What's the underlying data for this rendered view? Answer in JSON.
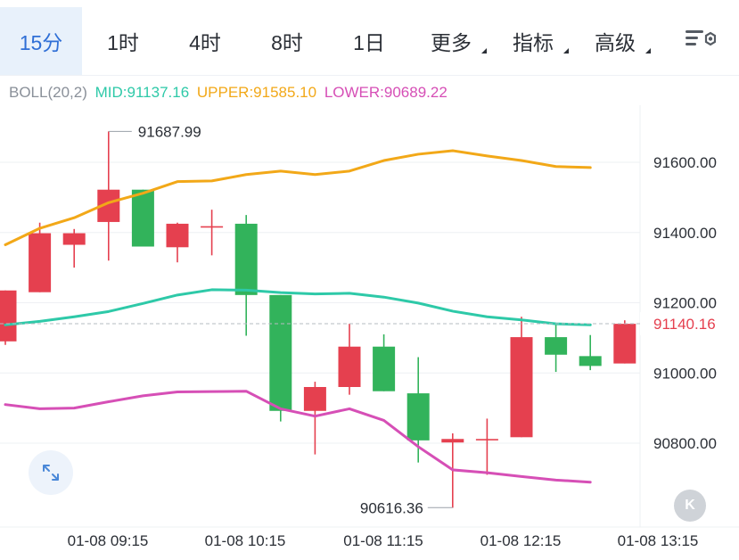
{
  "tabs": [
    {
      "label": "15分",
      "active": true,
      "caret": false
    },
    {
      "label": "1时",
      "active": false,
      "caret": false
    },
    {
      "label": "4时",
      "active": false,
      "caret": false
    },
    {
      "label": "8时",
      "active": false,
      "caret": false
    },
    {
      "label": "1日",
      "active": false,
      "caret": false
    },
    {
      "label": "更多",
      "active": false,
      "caret": true
    },
    {
      "label": "指标",
      "active": false,
      "caret": true
    },
    {
      "label": "高级",
      "active": false,
      "caret": true
    }
  ],
  "icons": {
    "settings": "chart-settings-icon",
    "expand": "expand-icon",
    "collapse": "k-collapse-icon"
  },
  "boll": {
    "name": "BOLL(20,2)",
    "mid": "MID:91137.16",
    "upper": "UPPER:91585.10",
    "lower": "LOWER:90689.22"
  },
  "colors": {
    "up": "#e5404f",
    "down": "#32b35b",
    "mid": "#2ec9a8",
    "upper": "#f2a818",
    "lower": "#d64fb6",
    "last_price": "#e5404f",
    "accent": "#2f6fd6"
  },
  "kbutton_label": "K",
  "chart_data": {
    "type": "candlestick",
    "y_ticks": [
      "91600.00",
      "91400.00",
      "91200.00",
      "91000.00",
      "90800.00"
    ],
    "y_tick_values": [
      91600,
      91400,
      91200,
      91000,
      90800
    ],
    "x_labels": [
      "01-08 09:15",
      "01-08 10:15",
      "01-08 11:15",
      "01-08 12:15",
      "01-08 13:15"
    ],
    "last_price": 91140.16,
    "last_price_label": "91140.16",
    "max_label": "91687.99",
    "min_label": "90616.36",
    "max_value": 91687.99,
    "min_value": 90616.36,
    "candles": [
      {
        "o": 91090,
        "h": 91235,
        "l": 91080,
        "c": 91235
      },
      {
        "o": 91230,
        "h": 91428,
        "l": 91230,
        "c": 91398
      },
      {
        "o": 91365,
        "h": 91410,
        "l": 91300,
        "c": 91398
      },
      {
        "o": 91430,
        "h": 91688,
        "l": 91320,
        "c": 91522
      },
      {
        "o": 91522,
        "h": 91522,
        "l": 91360,
        "c": 91360
      },
      {
        "o": 91358,
        "h": 91428,
        "l": 91315,
        "c": 91425
      },
      {
        "o": 91418,
        "h": 91465,
        "l": 91335,
        "c": 91418
      },
      {
        "o": 91425,
        "h": 91450,
        "l": 91106,
        "c": 91222
      },
      {
        "o": 91222,
        "h": 91222,
        "l": 90862,
        "c": 90892
      },
      {
        "o": 90892,
        "h": 90975,
        "l": 90768,
        "c": 90960
      },
      {
        "o": 90960,
        "h": 91140,
        "l": 90938,
        "c": 91075
      },
      {
        "o": 91075,
        "h": 91110,
        "l": 90948,
        "c": 90948
      },
      {
        "o": 90942,
        "h": 91045,
        "l": 90745,
        "c": 90808
      },
      {
        "o": 90802,
        "h": 90828,
        "l": 90616,
        "c": 90812
      },
      {
        "o": 90812,
        "h": 90870,
        "l": 90710,
        "c": 90812
      },
      {
        "o": 90817,
        "h": 91160,
        "l": 90817,
        "c": 91102
      },
      {
        "o": 91102,
        "h": 91140,
        "l": 91003,
        "c": 91052
      },
      {
        "o": 91048,
        "h": 91108,
        "l": 91008,
        "c": 91020
      },
      {
        "o": 91027,
        "h": 91150,
        "l": 91027,
        "c": 91140
      }
    ],
    "upper": [
      91365,
      91412,
      91442,
      91485,
      91512,
      91545,
      91547,
      91565,
      91575,
      91565,
      91575,
      91605,
      91623,
      91633,
      91618,
      91605,
      91588,
      91585
    ],
    "mid": [
      91137,
      91147,
      91160,
      91175,
      91198,
      91222,
      91237,
      91236,
      91229,
      91225,
      91227,
      91216,
      91199,
      91176,
      91160,
      91151,
      91140,
      91137
    ],
    "lower": [
      90910,
      90898,
      90900,
      90918,
      90935,
      90946,
      90947,
      90948,
      90898,
      90877,
      90898,
      90865,
      90790,
      90724,
      90716,
      90705,
      90695,
      90689
    ]
  }
}
